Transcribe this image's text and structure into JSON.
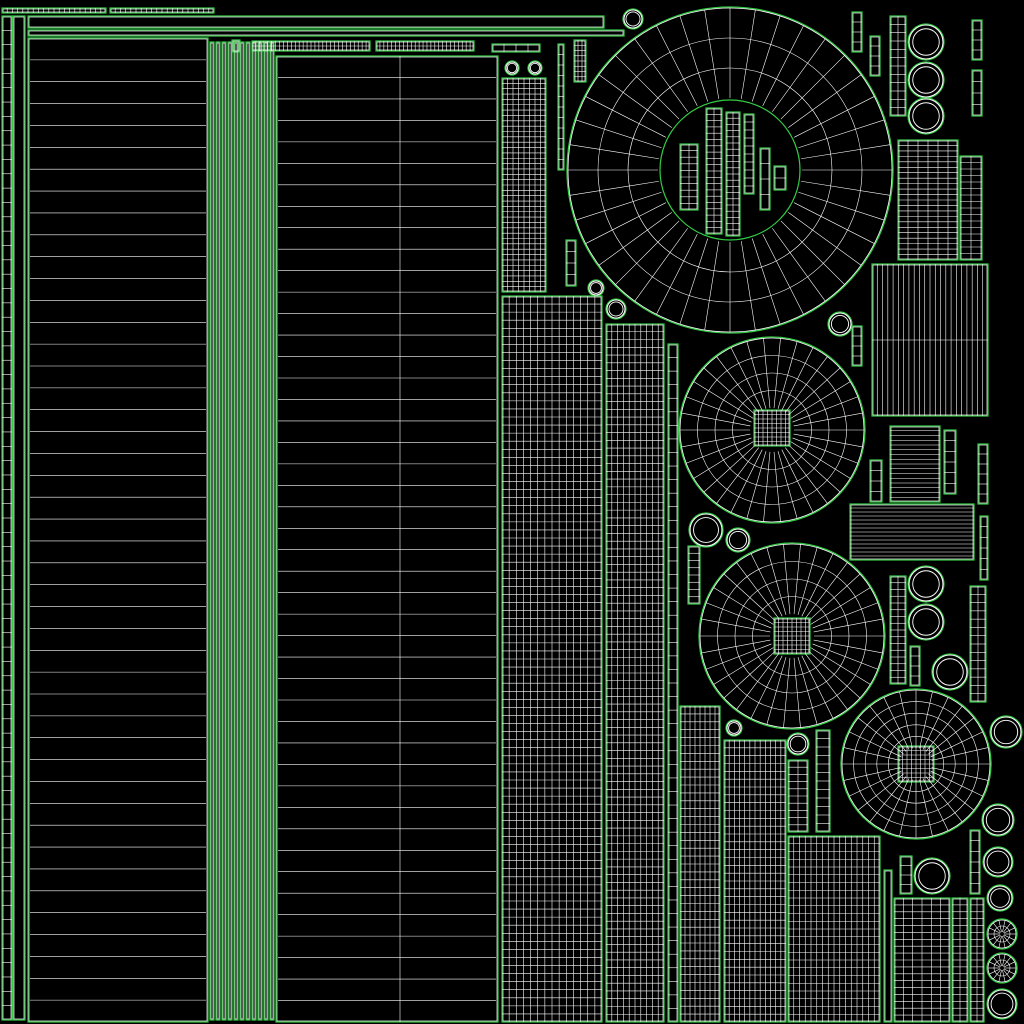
{
  "texture": {
    "kind": "uv-wireframe-layout",
    "background_color": "#000000",
    "wire_color": "#ffffff",
    "border_color": "#33cc44"
  }
}
